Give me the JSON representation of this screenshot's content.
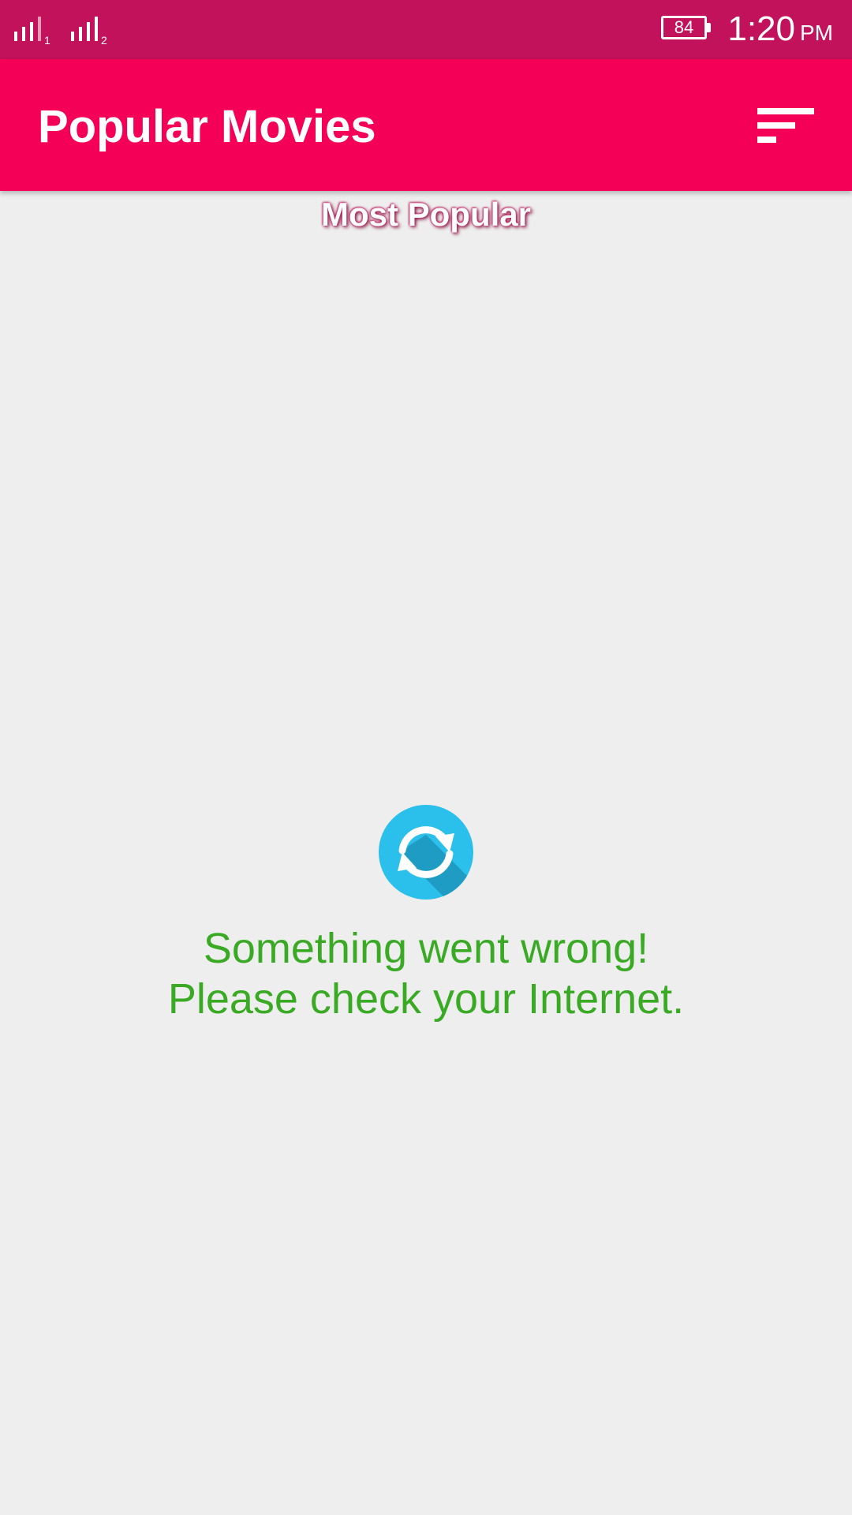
{
  "status_bar": {
    "sim1_index": "1",
    "sim2_index": "2",
    "battery_level": "84",
    "time": "1:20",
    "ampm": "PM",
    "icons": [
      "signal-sim1-icon",
      "signal-sim2-icon",
      "battery-icon"
    ]
  },
  "app_bar": {
    "title": "Popular Movies",
    "sort_icon": "sort-icon",
    "color": "#f50057"
  },
  "subtitle": "Most Popular",
  "error": {
    "icon": "refresh-icon",
    "line1": "Something went wrong!",
    "line2": "Please check your Internet.",
    "color": "#3aaa25"
  },
  "colors": {
    "status_bar": "#c2125b",
    "accent": "#f50057",
    "background": "#eeeeee",
    "refresh_icon": "#2bbfec"
  }
}
